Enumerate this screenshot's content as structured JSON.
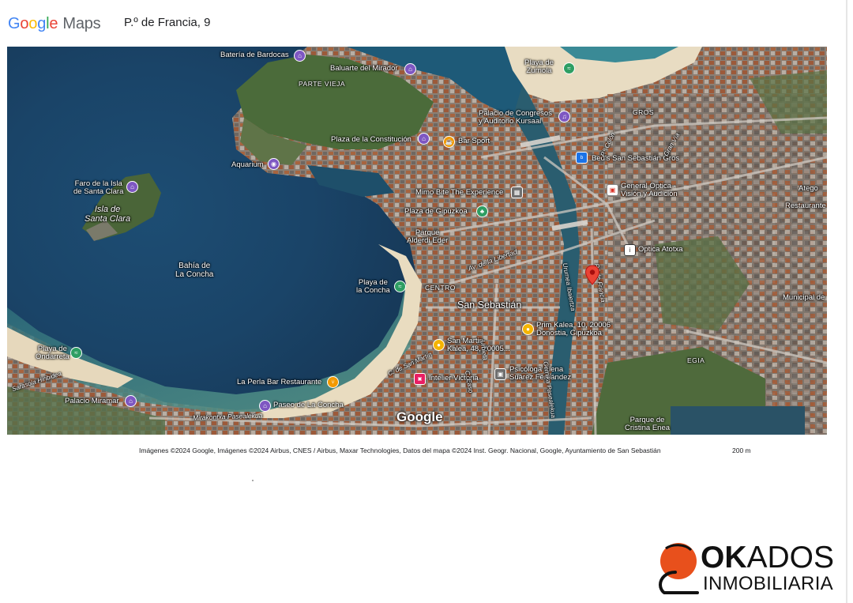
{
  "header": {
    "logo_letters": [
      "G",
      "o",
      "o",
      "g",
      "l",
      "e"
    ],
    "logo_maps": "Maps",
    "address": "P.º de Francia, 9"
  },
  "map": {
    "labels": {
      "bateria": "Batería de Bardocas",
      "baluarte": "Baluarte del Mirador",
      "parte_vieja": "PARTE VIEJA",
      "zurriola": "Playa de\nZurriola",
      "kursaal": "Palacio de Congresos\ny Auditorio Kursaal",
      "gros": "GROS",
      "constitucion": "Plaza de la Constitución",
      "bar_sport": "Bar Sport",
      "aquarium": "Aquarium",
      "faro": "Faro de la Isla\nde Santa Clara",
      "isla": "Isla de\nSanta Clara",
      "beds": "Bed's San Sebastián Gros",
      "general_optica": "General Optica -\nVisión y Audición",
      "mimo": "Mimo Bite The Experience",
      "gipuzkoa": "Plaza de Gipuzkoa",
      "alderdi": "Parque\nAlderdi Eder",
      "bahia": "Bahía de\nLa Concha",
      "optica_atotxa": "Optica Atotxa",
      "playa_concha": "Playa de\nla Concha",
      "centro": "CENTRO",
      "san_sebastian": "San Sebastián",
      "prim": "Prim Kalea, 10, 20006\nDonostia, Gipuzkoa",
      "san_martin": "San Martin\nKalea, 48, 20005...",
      "ondarreta": "Playa de\nOndarreta",
      "perla": "La Perla Bar Restaurante",
      "intelier": "Intelier Victoria",
      "psicologa": "Psicóloga Elena\nSuárez Fernández",
      "egia": "EGIA",
      "miramar": "Palacio Miramar",
      "paseo_concha": "Paseo de La Concha",
      "mirakontxa": "Mirakontxa Pasealekua",
      "parque_cristina": "Parque de\nCristina Enea",
      "restaurante": "Restaurante",
      "municipal": "Municipal de",
      "atego": "Atego",
      "libertad": "Av. de la Libertad",
      "urumea": "Urumea Ibaiertza",
      "francia": "P.º de Francia",
      "colon": "P.º Colón",
      "gran_via": "Gran Vía",
      "kcha": "La Concha",
      "san_martin_st": "C. de San Martín",
      "easo": "C. Easo",
      "gernika": "Gernika Pasealekua",
      "urbieta": "Urbieta",
      "zarautz": "Sarasola Hiribidea"
    },
    "google_logo": "Google"
  },
  "footer": {
    "attribution": "Imágenes ©2024 Google, Imágenes ©2024 Airbus, CNES / Airbus, Maxar Technologies, Datos del mapa ©2024 Inst. Geogr. Nacional, Google, Ayuntamiento de San Sebastián",
    "scale": "200 m"
  },
  "brand": {
    "ok": "OK",
    "ados": "ADOS",
    "sub": "INMOBILIARIA"
  },
  "colors": {
    "sea_deep": "#1f4a6e",
    "sea_shallow": "#3f8a8a",
    "sand": "#e8dcc2",
    "city": "#8a7e74",
    "vegetation": "#4b6b3a",
    "brand_orange": "#e8501c"
  }
}
